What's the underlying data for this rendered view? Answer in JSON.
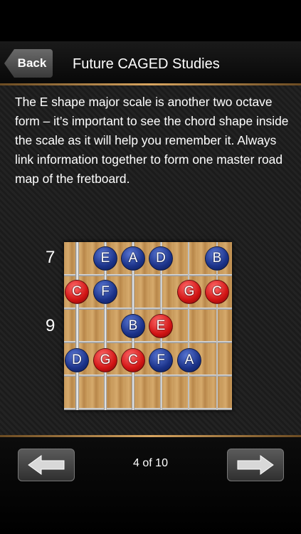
{
  "nav": {
    "back_label": "Back",
    "title": "Future CAGED Studies"
  },
  "body": {
    "text": "The E shape major scale is another two octave form – it’s important to see the chord shape inside the scale as it will help you remember it. Always link information together to form one master road map of the fretboard."
  },
  "diagram": {
    "fret_labels": [
      "7",
      "9"
    ],
    "notes": [
      {
        "label": "E",
        "color": "blue",
        "string": 2,
        "fret": 0
      },
      {
        "label": "A",
        "color": "blue",
        "string": 3,
        "fret": 0
      },
      {
        "label": "D",
        "color": "blue",
        "string": 4,
        "fret": 0
      },
      {
        "label": "B",
        "color": "blue",
        "string": 6,
        "fret": 0
      },
      {
        "label": "C",
        "color": "red",
        "string": 1,
        "fret": 1
      },
      {
        "label": "F",
        "color": "blue",
        "string": 2,
        "fret": 1
      },
      {
        "label": "G",
        "color": "red",
        "string": 5,
        "fret": 1
      },
      {
        "label": "C",
        "color": "red",
        "string": 6,
        "fret": 1
      },
      {
        "label": "B",
        "color": "blue",
        "string": 3,
        "fret": 2
      },
      {
        "label": "E",
        "color": "red",
        "string": 4,
        "fret": 2
      },
      {
        "label": "D",
        "color": "blue",
        "string": 1,
        "fret": 3
      },
      {
        "label": "G",
        "color": "red",
        "string": 2,
        "fret": 3
      },
      {
        "label": "C",
        "color": "red",
        "string": 3,
        "fret": 3
      },
      {
        "label": "F",
        "color": "blue",
        "string": 4,
        "fret": 3
      },
      {
        "label": "A",
        "color": "blue",
        "string": 5,
        "fret": 3
      }
    ]
  },
  "toolbar": {
    "page_indicator": "4 of 10",
    "prev_icon": "left-arrow-icon",
    "next_icon": "right-arrow-icon"
  }
}
